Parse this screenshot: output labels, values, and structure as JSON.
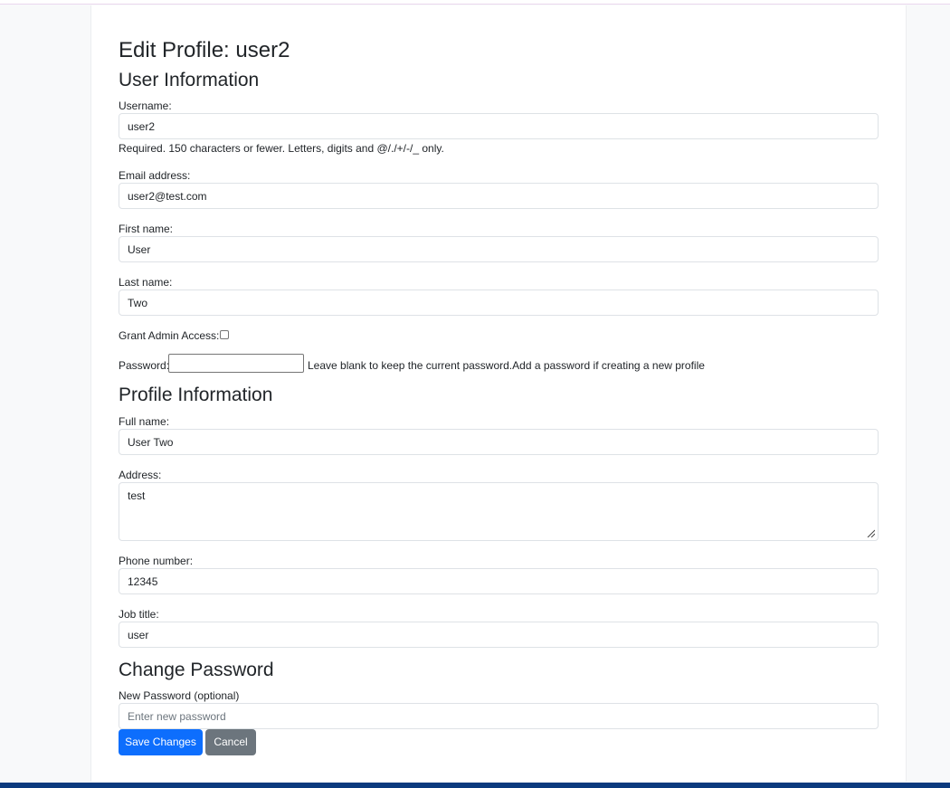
{
  "page": {
    "title": "Edit Profile: user2"
  },
  "user_info": {
    "heading": "User Information",
    "username": {
      "label": "Username:",
      "value": "user2",
      "help": "Required. 150 characters or fewer. Letters, digits and @/./+/-/_ only."
    },
    "email": {
      "label": "Email address:",
      "value": "user2@test.com"
    },
    "first_name": {
      "label": "First name:",
      "value": "User"
    },
    "last_name": {
      "label": "Last name:",
      "value": "Two"
    },
    "admin": {
      "label": "Grant Admin Access:",
      "checked": false
    },
    "password": {
      "label": "Password:",
      "value": "",
      "help": "Leave blank to keep the current password.Add a password if creating a new profile"
    }
  },
  "profile_info": {
    "heading": "Profile Information",
    "full_name": {
      "label": "Full name:",
      "value": "User Two"
    },
    "address": {
      "label": "Address:",
      "value": "test"
    },
    "phone": {
      "label": "Phone number:",
      "value": "12345"
    },
    "job_title": {
      "label": "Job title:",
      "value": "user"
    }
  },
  "change_password": {
    "heading": "Change Password",
    "new_password": {
      "label": "New Password (optional)",
      "placeholder": "Enter new password",
      "value": ""
    }
  },
  "actions": {
    "save_label": "Save Changes",
    "cancel_label": "Cancel"
  },
  "colors": {
    "primary": "#0d6efd",
    "secondary": "#6c757d",
    "footer": "#0b3a7e"
  }
}
